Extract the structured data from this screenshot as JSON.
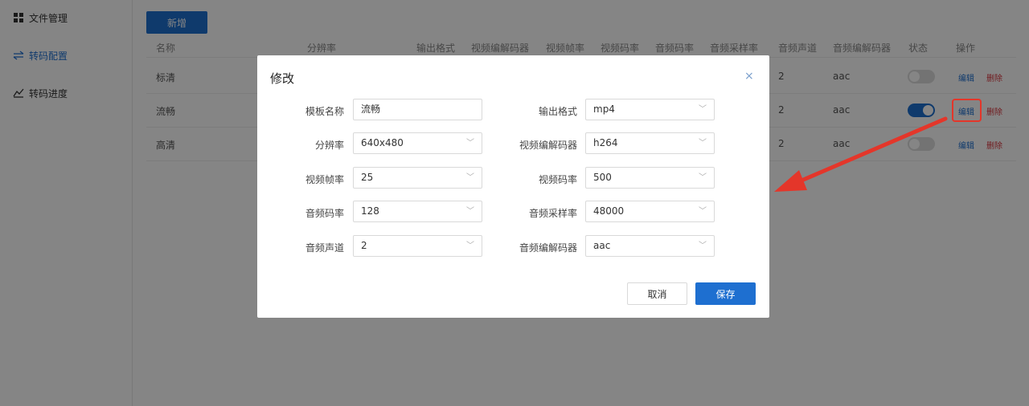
{
  "sidebar": {
    "items": [
      {
        "label": "文件管理",
        "icon": "grid-icon"
      },
      {
        "label": "转码配置",
        "icon": "swap-icon"
      },
      {
        "label": "转码进度",
        "icon": "chart-icon"
      }
    ]
  },
  "toolbar": {
    "add_label": "新增"
  },
  "table": {
    "headers": [
      "名称",
      "分辨率",
      "输出格式",
      "视频编解码器",
      "视频帧率",
      "视频码率",
      "音频码率",
      "音频采样率",
      "音频声道",
      "音频编解码器",
      "状态",
      "操作"
    ],
    "rows": [
      {
        "name": "标清",
        "channels": "2",
        "codec": "aac",
        "enabled": false,
        "edit": "编辑",
        "delete": "删除"
      },
      {
        "name": "流畅",
        "channels": "2",
        "codec": "aac",
        "enabled": true,
        "edit": "编辑",
        "delete": "删除"
      },
      {
        "name": "高清",
        "channels": "2",
        "codec": "aac",
        "enabled": false,
        "edit": "编辑",
        "delete": "删除"
      }
    ]
  },
  "modal": {
    "title": "修改",
    "close": "×",
    "fields": {
      "template_name": {
        "label": "模板名称",
        "value": "流畅"
      },
      "output_format": {
        "label": "输出格式",
        "value": "mp4"
      },
      "resolution": {
        "label": "分辨率",
        "value": "640x480"
      },
      "video_codec": {
        "label": "视频编解码器",
        "value": "h264"
      },
      "video_fps": {
        "label": "视频帧率",
        "value": "25"
      },
      "video_bitrate": {
        "label": "视频码率",
        "value": "500"
      },
      "audio_bitrate": {
        "label": "音频码率",
        "value": "128"
      },
      "audio_sample_rate": {
        "label": "音频采样率",
        "value": "48000"
      },
      "audio_channels": {
        "label": "音频声道",
        "value": "2"
      },
      "audio_codec": {
        "label": "音频编解码器",
        "value": "aac"
      }
    },
    "cancel_label": "取消",
    "save_label": "保存"
  },
  "colors": {
    "primary": "#1e6fd0",
    "danger": "#d9363e",
    "annotation": "#e4362a"
  }
}
